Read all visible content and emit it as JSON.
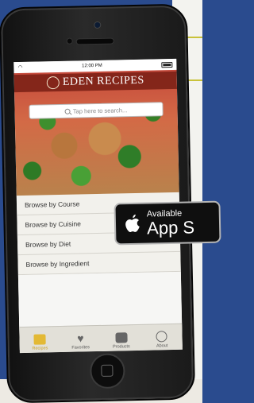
{
  "status_bar": {
    "time": "12:00 PM"
  },
  "header": {
    "brand_title": "EDEN RECIPES"
  },
  "search": {
    "placeholder": "Tap here to search..."
  },
  "browse_items": [
    {
      "label": "Browse by Course"
    },
    {
      "label": "Browse by Cuisine"
    },
    {
      "label": "Browse by Diet"
    },
    {
      "label": "Browse by Ingredient"
    }
  ],
  "tabs": [
    {
      "label": "Recipes",
      "icon": "folder-icon",
      "active": true
    },
    {
      "label": "Favorites",
      "icon": "heart-icon"
    },
    {
      "label": "Products",
      "icon": "products-icon"
    },
    {
      "label": "About",
      "icon": "about-icon"
    }
  ],
  "badge": {
    "line1": "Available",
    "line2": "App S"
  },
  "colors": {
    "accent_tab": "#c9a22b",
    "brand_bar": "#781e14"
  }
}
